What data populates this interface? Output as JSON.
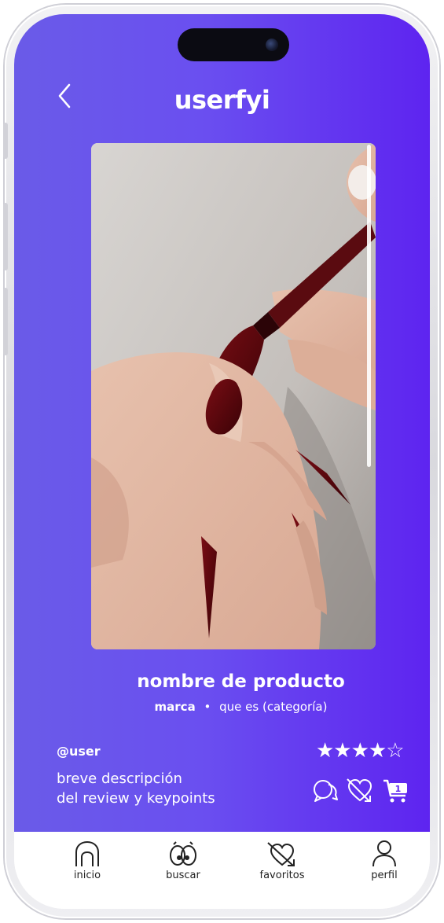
{
  "header": {
    "brand": "userfyi"
  },
  "product": {
    "name": "nombre de producto",
    "brand": "marca",
    "separator": "•",
    "category": "que es (categoría)"
  },
  "review": {
    "user": "@user",
    "description_line1": "breve descripción",
    "description_line2": "del review y keypoints",
    "rating": 4,
    "rating_max": 5,
    "stars_display": "★★★★☆"
  },
  "actions": {
    "cart_count": "1"
  },
  "tabs": [
    {
      "label": "inicio",
      "icon": "home-icon"
    },
    {
      "label": "buscar",
      "icon": "search-eyes-icon"
    },
    {
      "label": "favoritos",
      "icon": "heart-arrow-icon"
    },
    {
      "label": "perfil",
      "icon": "user-icon"
    }
  ],
  "colors": {
    "gradient_start": "#6a5be8",
    "gradient_end": "#5e24f0",
    "text": "#ffffff",
    "tabbar_bg": "#ffffff"
  }
}
